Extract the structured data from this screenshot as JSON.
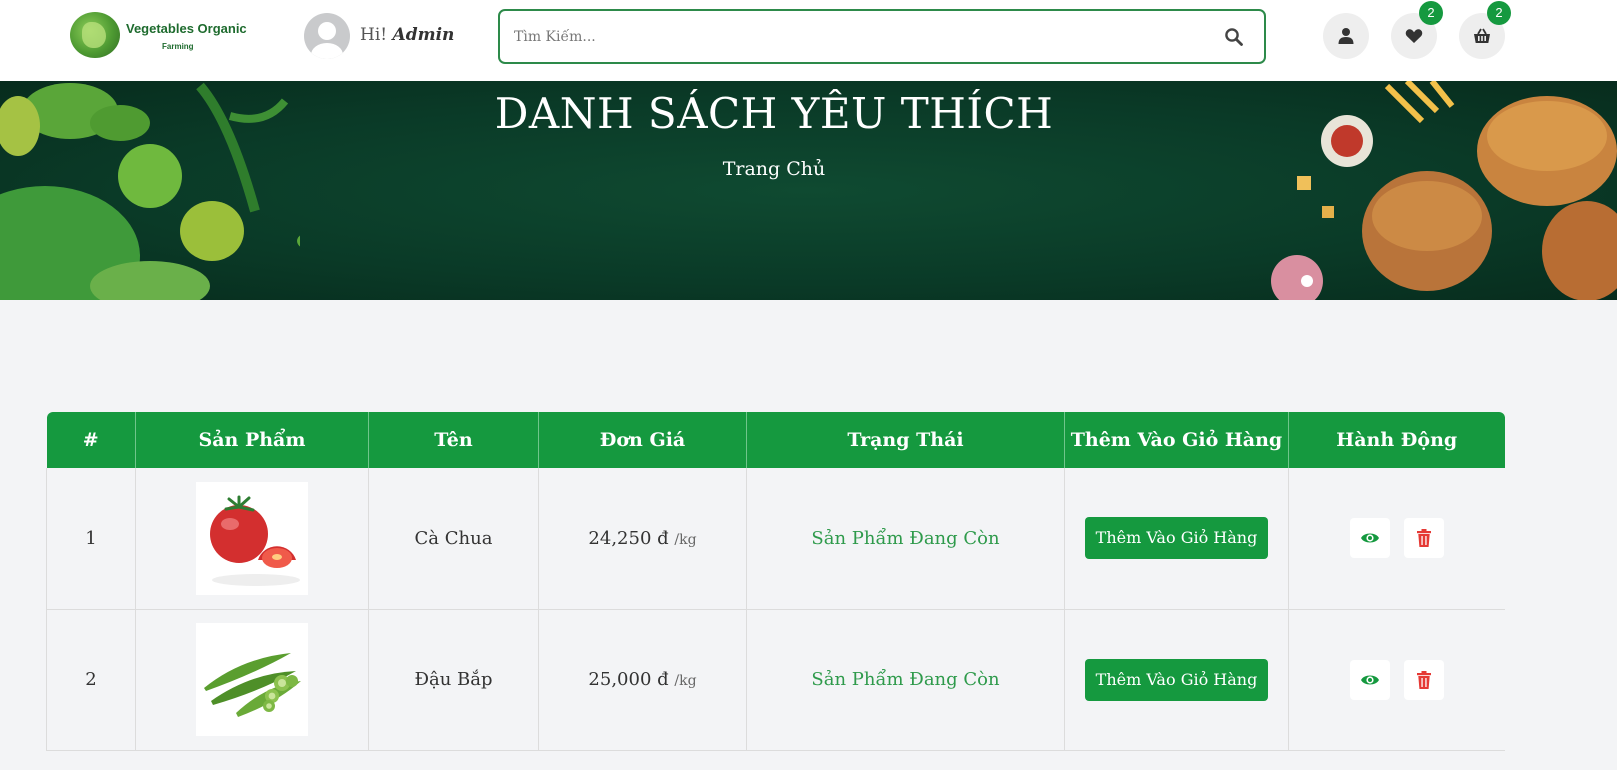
{
  "brand": {
    "name": "Vegetables Organic",
    "tagline": "Farming"
  },
  "header": {
    "greeting_prefix": "Hi!",
    "username": "Admin",
    "search_placeholder": "Tìm Kiếm...",
    "wishlist_count": "2",
    "cart_count": "2"
  },
  "banner": {
    "title": "DANH SÁCH YÊU THÍCH",
    "breadcrumb": "Trang Chủ"
  },
  "table": {
    "headers": [
      "#",
      "Sản Phẩm",
      "Tên",
      "Đơn Giá",
      "Trạng Thái",
      "Thêm Vào Giỏ Hàng",
      "Hành Động"
    ],
    "rows": [
      {
        "index": "1",
        "image": "tomato",
        "name": "Cà Chua",
        "price": "24,250 đ",
        "unit": "/kg",
        "status": "Sản Phẩm Đang Còn",
        "add_label": "Thêm Vào Giỏ Hàng"
      },
      {
        "index": "2",
        "image": "okra",
        "name": "Đậu Bắp",
        "price": "25,000 đ",
        "unit": "/kg",
        "status": "Sản Phẩm Đang Còn",
        "add_label": "Thêm Vào Giỏ Hàng"
      }
    ]
  },
  "icons": {
    "search": "search-icon",
    "user": "user-icon",
    "wishlist": "heart-icon",
    "cart": "basket-icon",
    "view": "eye-icon",
    "delete": "trash-icon"
  },
  "colors": {
    "primary": "#15993f",
    "status_text": "#2e9a4b",
    "delete": "#e53935",
    "banner": "#0a3a27"
  }
}
